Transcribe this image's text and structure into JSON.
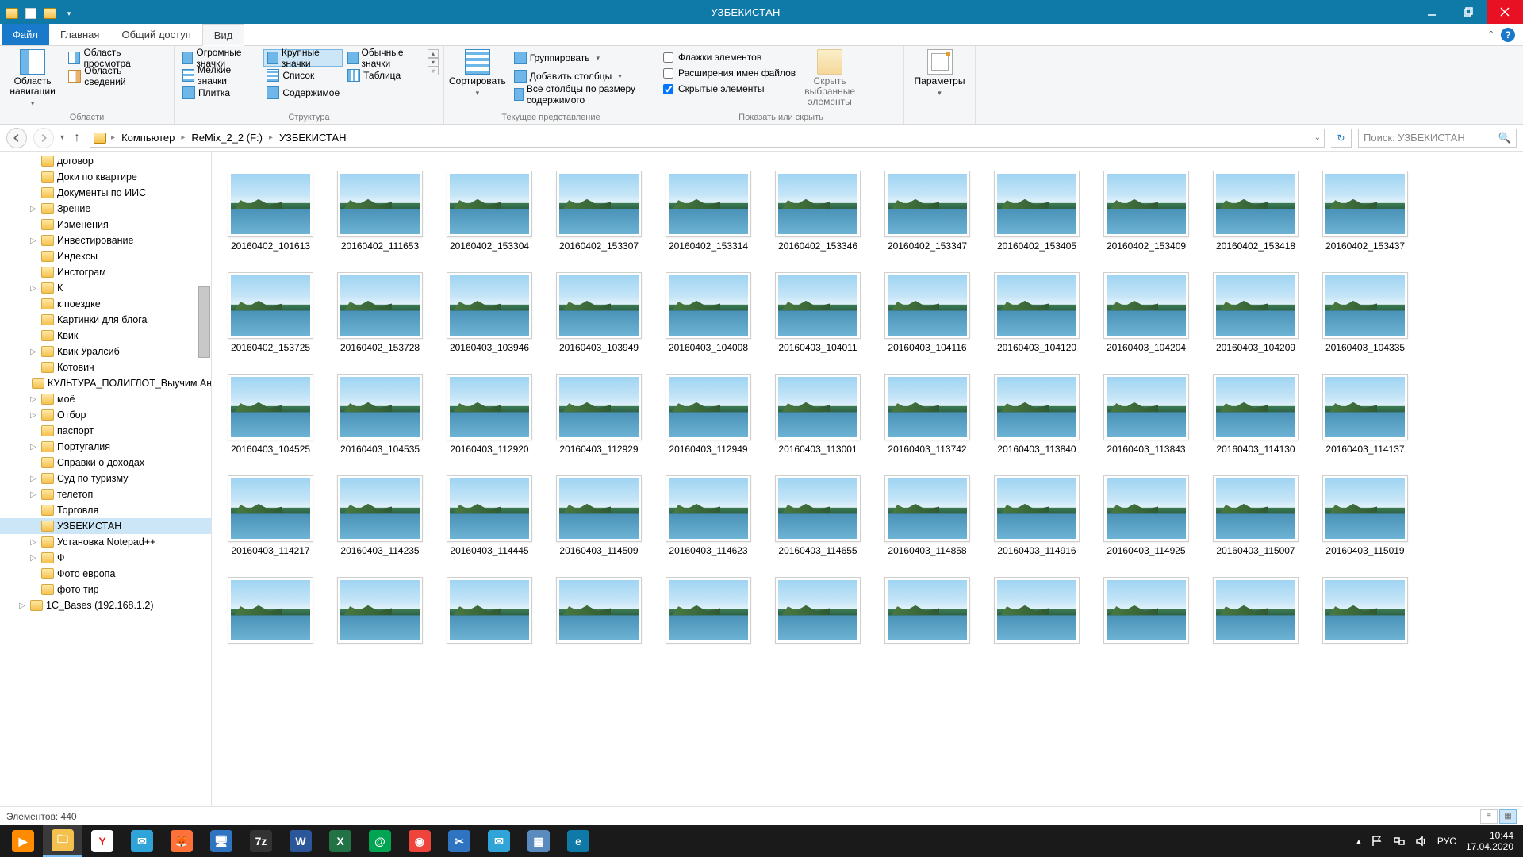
{
  "window": {
    "title": "УЗБЕКИСТАН"
  },
  "ribbon_tabs": {
    "file": "Файл",
    "home": "Главная",
    "share": "Общий доступ",
    "view": "Вид"
  },
  "ribbon": {
    "panes_group": "Области",
    "nav_pane": "Область навигации",
    "preview_pane": "Область просмотра",
    "details_pane": "Область сведений",
    "layout_group": "Структура",
    "xl_icons": "Огромные значки",
    "lg_icons": "Крупные значки",
    "md_icons": "Обычные значки",
    "sm_icons": "Мелкие значки",
    "list": "Список",
    "table": "Таблица",
    "tiles": "Плитка",
    "content": "Содержимое",
    "view_group": "Текущее представление",
    "sort": "Сортировать",
    "group_by": "Группировать",
    "add_cols": "Добавить столбцы",
    "size_cols": "Все столбцы по размеру содержимого",
    "showhide_group": "Показать или скрыть",
    "chk_item_boxes": "Флажки элементов",
    "chk_ext": "Расширения имен файлов",
    "chk_hidden": "Скрытые элементы",
    "hide_selected": "Скрыть выбранные элементы",
    "options": "Параметры"
  },
  "breadcrumb": {
    "computer": "Компьютер",
    "drive": "ReMix_2_2 (F:)",
    "folder": "УЗБЕКИСТАН"
  },
  "search": {
    "placeholder": "Поиск: УЗБЕКИСТАН"
  },
  "tree": [
    {
      "l": "договор",
      "d": 2,
      "e": ""
    },
    {
      "l": "Доки по квартире",
      "d": 2,
      "e": ""
    },
    {
      "l": "Документы по ИИС",
      "d": 2,
      "e": ""
    },
    {
      "l": "Зрение",
      "d": 2,
      "e": "▷"
    },
    {
      "l": "Изменения",
      "d": 2,
      "e": ""
    },
    {
      "l": "Инвестирование",
      "d": 2,
      "e": "▷"
    },
    {
      "l": "Индексы",
      "d": 2,
      "e": ""
    },
    {
      "l": "Инстограм",
      "d": 2,
      "e": ""
    },
    {
      "l": "К",
      "d": 2,
      "e": "▷"
    },
    {
      "l": "к поездке",
      "d": 2,
      "e": ""
    },
    {
      "l": "Картинки для блога",
      "d": 2,
      "e": ""
    },
    {
      "l": "Квик",
      "d": 2,
      "e": ""
    },
    {
      "l": "Квик Уралсиб",
      "d": 2,
      "e": "▷"
    },
    {
      "l": "Котович",
      "d": 2,
      "e": ""
    },
    {
      "l": "КУЛЬТУРА_ПОЛИГЛОТ_Выучим Англий",
      "d": 2,
      "e": ""
    },
    {
      "l": "моё",
      "d": 2,
      "e": "▷"
    },
    {
      "l": "Отбор",
      "d": 2,
      "e": "▷"
    },
    {
      "l": "паспорт",
      "d": 2,
      "e": ""
    },
    {
      "l": "Португалия",
      "d": 2,
      "e": "▷"
    },
    {
      "l": "Справки о доходах",
      "d": 2,
      "e": ""
    },
    {
      "l": "Суд по туризму",
      "d": 2,
      "e": "▷"
    },
    {
      "l": "телетоп",
      "d": 2,
      "e": "▷"
    },
    {
      "l": "Торговля",
      "d": 2,
      "e": ""
    },
    {
      "l": "УЗБЕКИСТАН",
      "d": 2,
      "e": "",
      "sel": true
    },
    {
      "l": "Установка Notepad++",
      "d": 2,
      "e": "▷"
    },
    {
      "l": "Ф",
      "d": 2,
      "e": "▷"
    },
    {
      "l": "Фото европа",
      "d": 2,
      "e": ""
    },
    {
      "l": "фото тир",
      "d": 2,
      "e": ""
    },
    {
      "l": "1C_Bases (192.168.1.2)",
      "d": 1,
      "e": "▷",
      "net": true
    }
  ],
  "files": [
    "20160402_101613",
    "20160402_111653",
    "20160402_153304",
    "20160402_153307",
    "20160402_153314",
    "20160402_153346",
    "20160402_153347",
    "20160402_153405",
    "20160402_153409",
    "20160402_153418",
    "20160402_153437",
    "20160402_153725",
    "20160402_153728",
    "20160403_103946",
    "20160403_103949",
    "20160403_104008",
    "20160403_104011",
    "20160403_104116",
    "20160403_104120",
    "20160403_104204",
    "20160403_104209",
    "20160403_104335",
    "20160403_104525",
    "20160403_104535",
    "20160403_112920",
    "20160403_112929",
    "20160403_112949",
    "20160403_113001",
    "20160403_113742",
    "20160403_113840",
    "20160403_113843",
    "20160403_114130",
    "20160403_114137",
    "20160403_114217",
    "20160403_114235",
    "20160403_114445",
    "20160403_114509",
    "20160403_114623",
    "20160403_114655",
    "20160403_114858",
    "20160403_114916",
    "20160403_114925",
    "20160403_115007",
    "20160403_115019",
    "",
    "",
    "",
    "",
    "",
    "",
    "",
    "",
    "",
    "",
    ""
  ],
  "status": {
    "count_label": "Элементов: 440"
  },
  "tray": {
    "lang": "РУС",
    "time": "10:44",
    "date": "17.04.2020"
  },
  "taskbar_apps": [
    {
      "name": "media-player",
      "bg": "#ff8c00",
      "txt": "▶"
    },
    {
      "name": "file-explorer",
      "bg": "#f5c14e",
      "txt": "🗀",
      "active": true
    },
    {
      "name": "yandex-browser",
      "bg": "#ffffff",
      "txt": "Y",
      "fg": "#e52620"
    },
    {
      "name": "mail",
      "bg": "#2fa4d8",
      "txt": "✉"
    },
    {
      "name": "firefox",
      "bg": "#ff7139",
      "txt": "🦊"
    },
    {
      "name": "rdp",
      "bg": "#2f74c0",
      "txt": "🖥"
    },
    {
      "name": "7zip",
      "bg": "#333",
      "txt": "7z"
    },
    {
      "name": "word",
      "bg": "#2b579a",
      "txt": "W"
    },
    {
      "name": "excel",
      "bg": "#217346",
      "txt": "X"
    },
    {
      "name": "at",
      "bg": "#00a551",
      "txt": "@"
    },
    {
      "name": "anydesk",
      "bg": "#ef443b",
      "txt": "◉"
    },
    {
      "name": "snip",
      "bg": "#2f74c0",
      "txt": "✂"
    },
    {
      "name": "thunderbird",
      "bg": "#2fa4d8",
      "txt": "✉"
    },
    {
      "name": "calc",
      "bg": "#5a8bbf",
      "txt": "▦"
    },
    {
      "name": "edge",
      "bg": "#0f7aa8",
      "txt": "e"
    }
  ]
}
